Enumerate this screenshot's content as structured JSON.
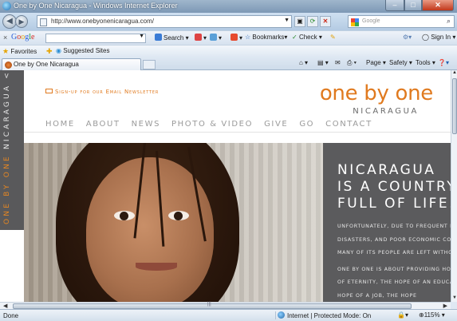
{
  "window": {
    "title": "One by One Nicaragua - Windows Internet Explorer",
    "controls": {
      "minimize": "–",
      "maximize": "□",
      "close": "✕"
    }
  },
  "address_bar": {
    "url": "http://www.onebyonenicaragua.com/",
    "search_placeholder": "Google"
  },
  "google_toolbar": {
    "logo": [
      "G",
      "o",
      "o",
      "g",
      "l",
      "e"
    ],
    "search_label": "Search",
    "bookmarks_label": "Bookmarks",
    "check_label": "Check",
    "signin_label": "Sign In"
  },
  "favorites_bar": {
    "favorites_label": "Favorites",
    "suggested_sites_label": "Suggested Sites"
  },
  "tabs": {
    "active_tab_label": "One by One Nicaragua",
    "command_bar": {
      "page": "Page",
      "safety": "Safety",
      "tools": "Tools"
    }
  },
  "site": {
    "vertical_brand": {
      "part1": "ONE BY ONE",
      "part2": "NICARAGUA"
    },
    "newsletter_label": "Sign-up for our Email Newsletter",
    "logo_main": "one by one",
    "logo_sub": "NICARAGUA",
    "nav": [
      "HOME",
      "ABOUT",
      "NEWS",
      "PHOTO & VIDEO",
      "GIVE",
      "GO",
      "CONTACT"
    ],
    "hero_headline": [
      "NICARAGUA",
      "IS A COUNTRY",
      "FULL OF LIFE."
    ],
    "hero_body": [
      "Unfortunately, due to frequent natural disasters, and poor economic conditions many of its people are left without hope.",
      "One by One is about providing hope. The hope of eternity, the hope of an education, the hope of a job, the hope"
    ]
  },
  "status_bar": {
    "status_text": "Done",
    "zone_text": "Internet | Protected Mode: On",
    "zoom": "115%"
  },
  "colors": {
    "brand_orange": "#e07a1f",
    "panel_gray": "#5b5b5d",
    "nav_gray": "#9a9a9a"
  }
}
